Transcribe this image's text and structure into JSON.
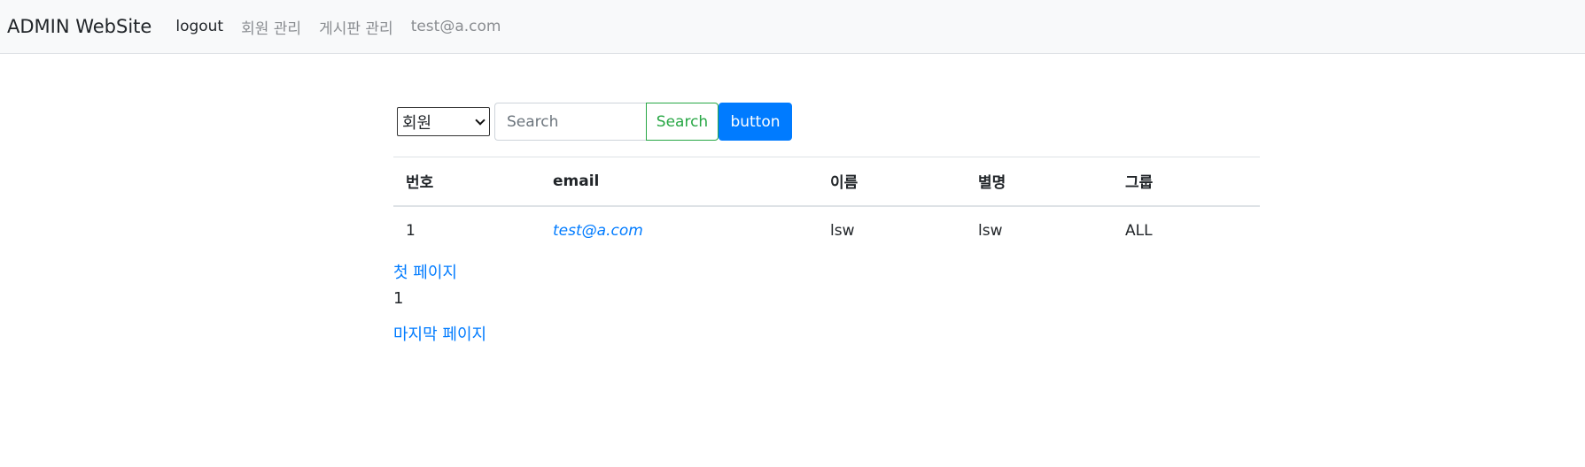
{
  "navbar": {
    "brand": "ADMIN WebSite",
    "links": [
      {
        "label": "logout"
      },
      {
        "label": "회원 관리"
      },
      {
        "label": "게시판 관리"
      },
      {
        "label": "test@a.com"
      }
    ]
  },
  "search": {
    "selected_option": "회원",
    "placeholder": "Search",
    "search_label": "Search",
    "button_label": "button"
  },
  "table": {
    "headers": [
      "번호",
      "email",
      "이름",
      "별명",
      "그룹"
    ],
    "rows": [
      {
        "no": "1",
        "email": "test@a.com",
        "name": "lsw",
        "nickname": "lsw",
        "group": "ALL"
      }
    ]
  },
  "pagination": {
    "first_label": "첫 페이지",
    "current_page": "1",
    "last_label": "마지막 페이지"
  },
  "colors": {
    "primary": "#007bff",
    "success": "#28a745",
    "navbar_bg": "#f8f9fa"
  }
}
